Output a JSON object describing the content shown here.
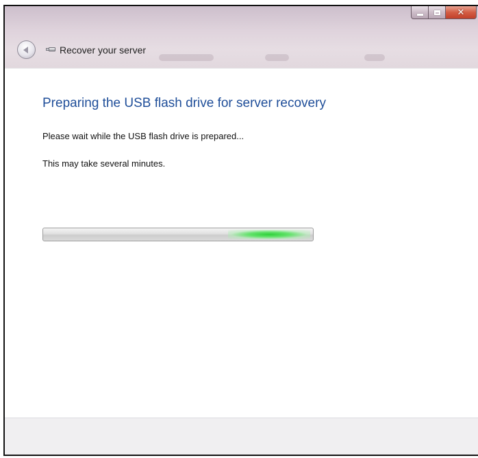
{
  "window": {
    "title": "Recover your server",
    "controls": {
      "minimize_icon": "minimize-icon",
      "maximize_icon": "maximize-icon",
      "close_glyph": "✕"
    }
  },
  "nav": {
    "back_icon": "back-arrow-icon",
    "app_icon": "usb-drive-icon"
  },
  "main": {
    "heading": "Preparing the USB flash drive for server recovery",
    "message": "Please wait while the USB flash drive is prepared...",
    "note": "This may take several minutes.",
    "progress": {
      "style": "marquee",
      "glow_color": "#2fd13a"
    }
  },
  "colors": {
    "heading": "#1f4e99",
    "close_button": "#c2402a"
  }
}
